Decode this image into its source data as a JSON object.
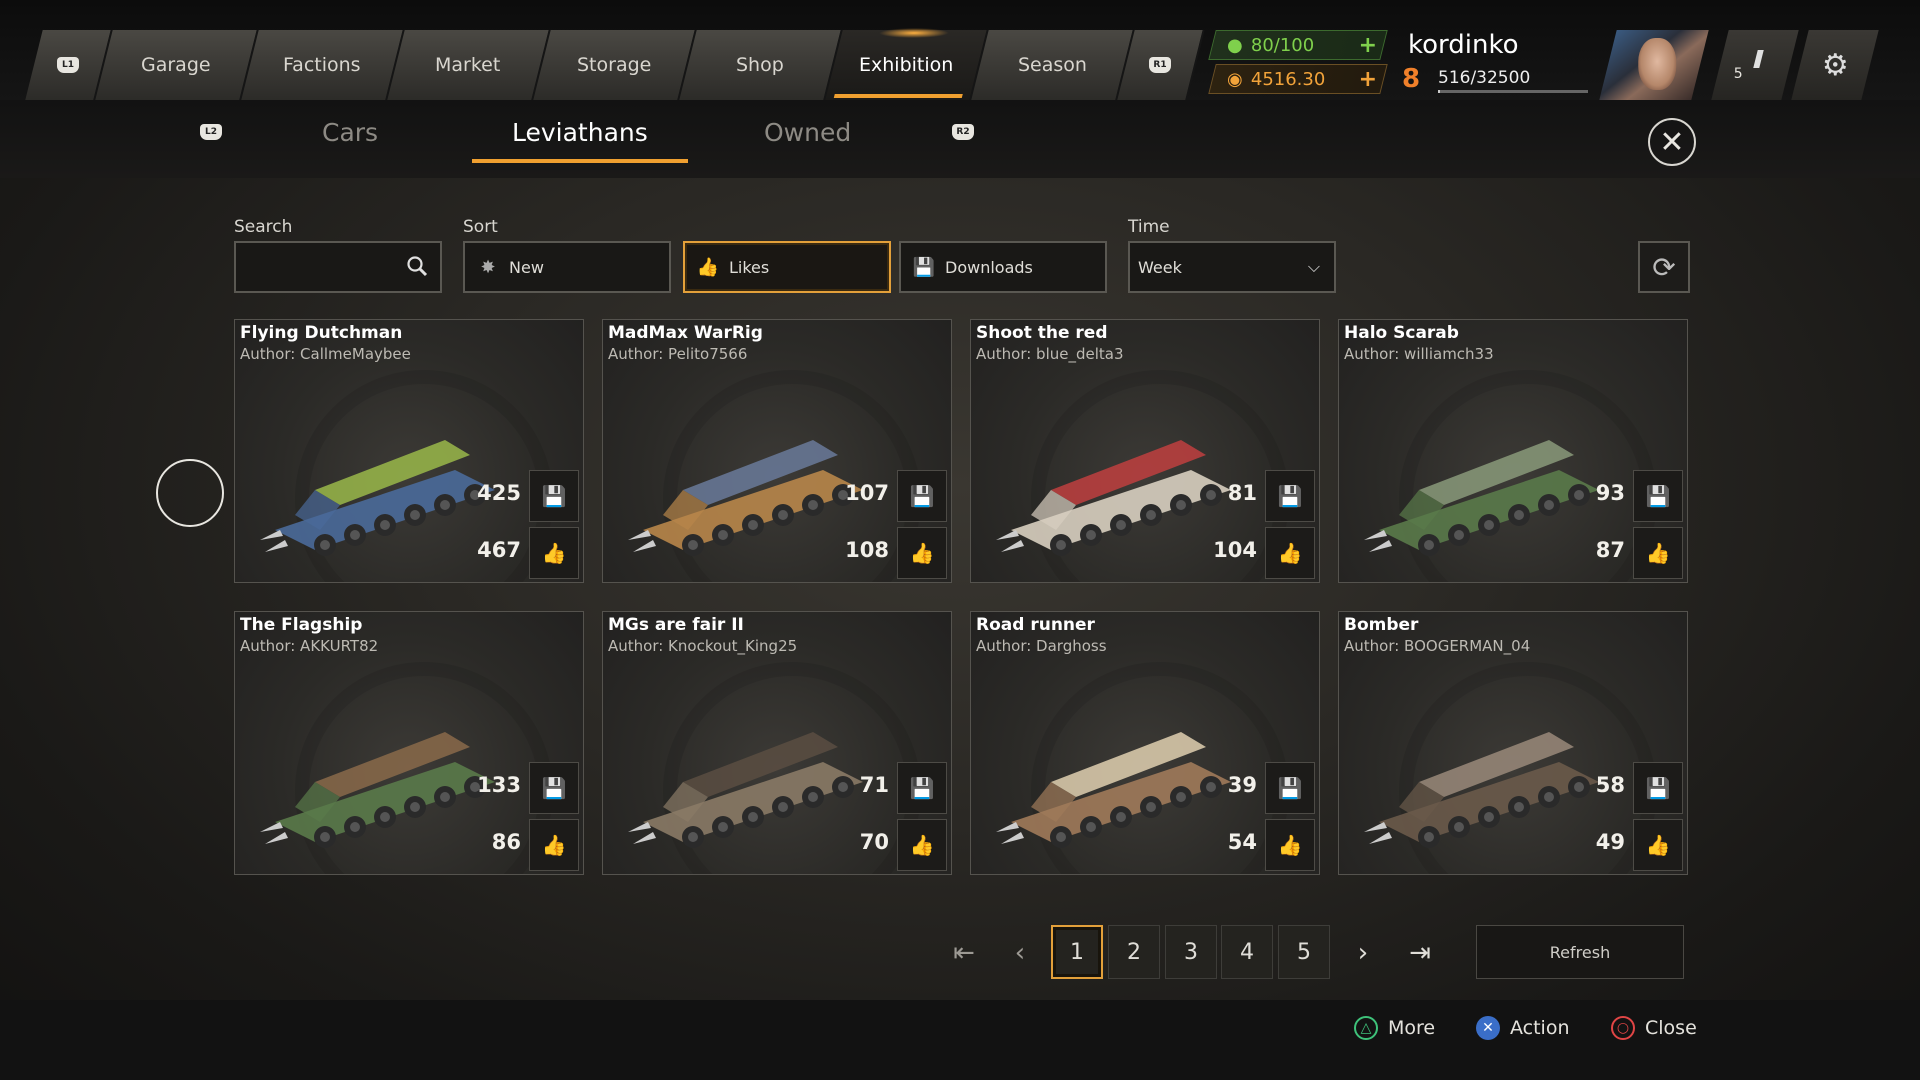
{
  "nav": {
    "left_button": "L1",
    "right_button": "R1",
    "tabs": [
      "Garage",
      "Factions",
      "Market",
      "Storage",
      "Shop",
      "Exhibition",
      "Season"
    ],
    "active": "Exhibition"
  },
  "resources": {
    "fuel": "80/100",
    "coins": "4516.30"
  },
  "profile": {
    "username": "kordinko",
    "level": "8",
    "xp": "516/32500",
    "xp_fraction": 0.016,
    "notifications": "5"
  },
  "subtabs": {
    "left_button": "L2",
    "right_button": "R2",
    "items": [
      "Cars",
      "Leviathans",
      "Owned"
    ],
    "active": "Leviathans"
  },
  "filters": {
    "search_label": "Search",
    "search_value": "",
    "sort_label": "Sort",
    "sort_options": [
      "New",
      "Likes",
      "Downloads"
    ],
    "sort_selected": "Likes",
    "time_label": "Time",
    "time_value": "Week"
  },
  "cards": [
    {
      "name": "Flying Dutchman",
      "author": "Author: CallmeMaybee",
      "downloads": "425",
      "likes": "467"
    },
    {
      "name": "MadMax WarRig",
      "author": "Author: Pelito7566",
      "downloads": "107",
      "likes": "108"
    },
    {
      "name": "Shoot the red",
      "author": "Author: blue_delta3",
      "downloads": "81",
      "likes": "104"
    },
    {
      "name": "Halo Scarab",
      "author": "Author: williamch33",
      "downloads": "93",
      "likes": "87"
    },
    {
      "name": "The Flagship",
      "author": "Author: AKKURT82",
      "downloads": "133",
      "likes": "86"
    },
    {
      "name": "MGs are fair II",
      "author": "Author: Knockout_King25",
      "downloads": "71",
      "likes": "70"
    },
    {
      "name": "Road runner",
      "author": "Author: Darghoss",
      "downloads": "39",
      "likes": "54"
    },
    {
      "name": "Bomber",
      "author": "Author: BOOGERMAN_04",
      "downloads": "58",
      "likes": "49"
    }
  ],
  "pagination": {
    "pages": [
      "1",
      "2",
      "3",
      "4",
      "5"
    ],
    "current": "1",
    "refresh_label": "Refresh"
  },
  "hints": {
    "more": "More",
    "action": "Action",
    "close": "Close"
  },
  "colors": {
    "accent": "#f0a030",
    "fuel_green": "#7fd04c",
    "coin_orange": "#f2a33a"
  }
}
